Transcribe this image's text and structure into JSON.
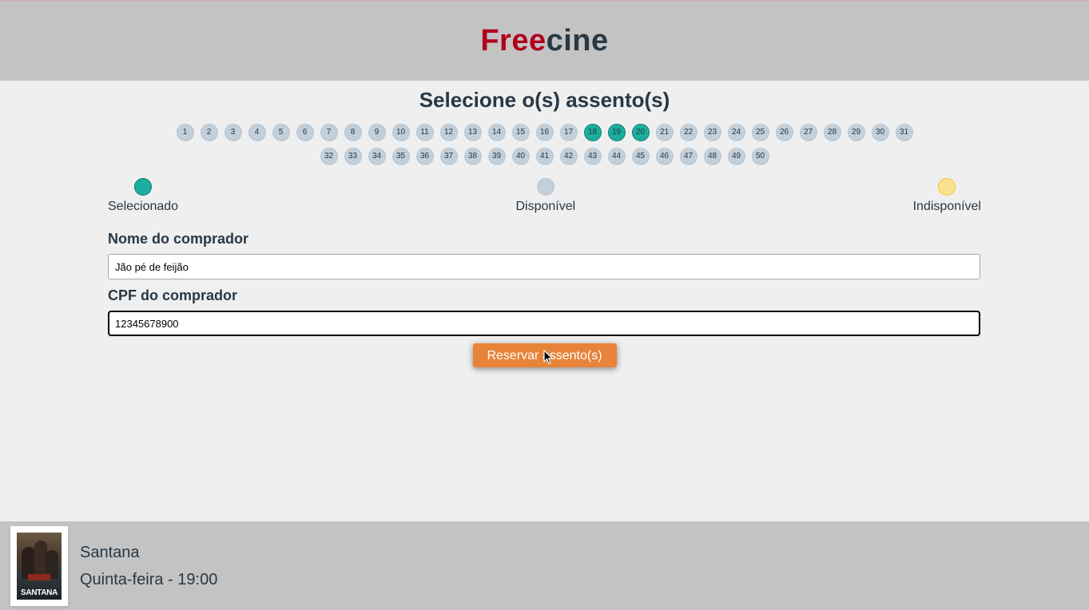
{
  "header": {
    "logo_part1": "Free",
    "logo_part2": "cine",
    "logo_colors": {
      "part1": "#b0001c",
      "part2": "#293845"
    }
  },
  "page_title": "Selecione o(s) assento(s)",
  "seats": {
    "numbers": [
      "1",
      "2",
      "3",
      "4",
      "5",
      "6",
      "7",
      "8",
      "9",
      "10",
      "11",
      "12",
      "13",
      "14",
      "15",
      "16",
      "17",
      "18",
      "19",
      "20",
      "21",
      "22",
      "23",
      "24",
      "25",
      "26",
      "27",
      "28",
      "29",
      "30",
      "31",
      "32",
      "33",
      "34",
      "35",
      "36",
      "37",
      "38",
      "39",
      "40",
      "41",
      "42",
      "43",
      "44",
      "45",
      "46",
      "47",
      "48",
      "49",
      "50"
    ],
    "selected": [
      "18",
      "19",
      "20"
    ],
    "unavailable": []
  },
  "legend": {
    "selected": "Selecionado",
    "available": "Disponível",
    "unavailable": "Indisponível"
  },
  "form": {
    "name_label": "Nome do comprador",
    "name_value": "Jão pé de feijão",
    "cpf_label": "CPF do comprador",
    "cpf_value": "12345678900",
    "submit_label": "Reservar assento(s)"
  },
  "colors": {
    "selected": "#1aae9e",
    "available": "#c3cfd9",
    "unavailable": "#fbe192",
    "button": "#e8833a"
  },
  "footer": {
    "poster_text": "SANTANA",
    "movie_title": "Santana",
    "session": "Quinta-feira - 19:00"
  }
}
